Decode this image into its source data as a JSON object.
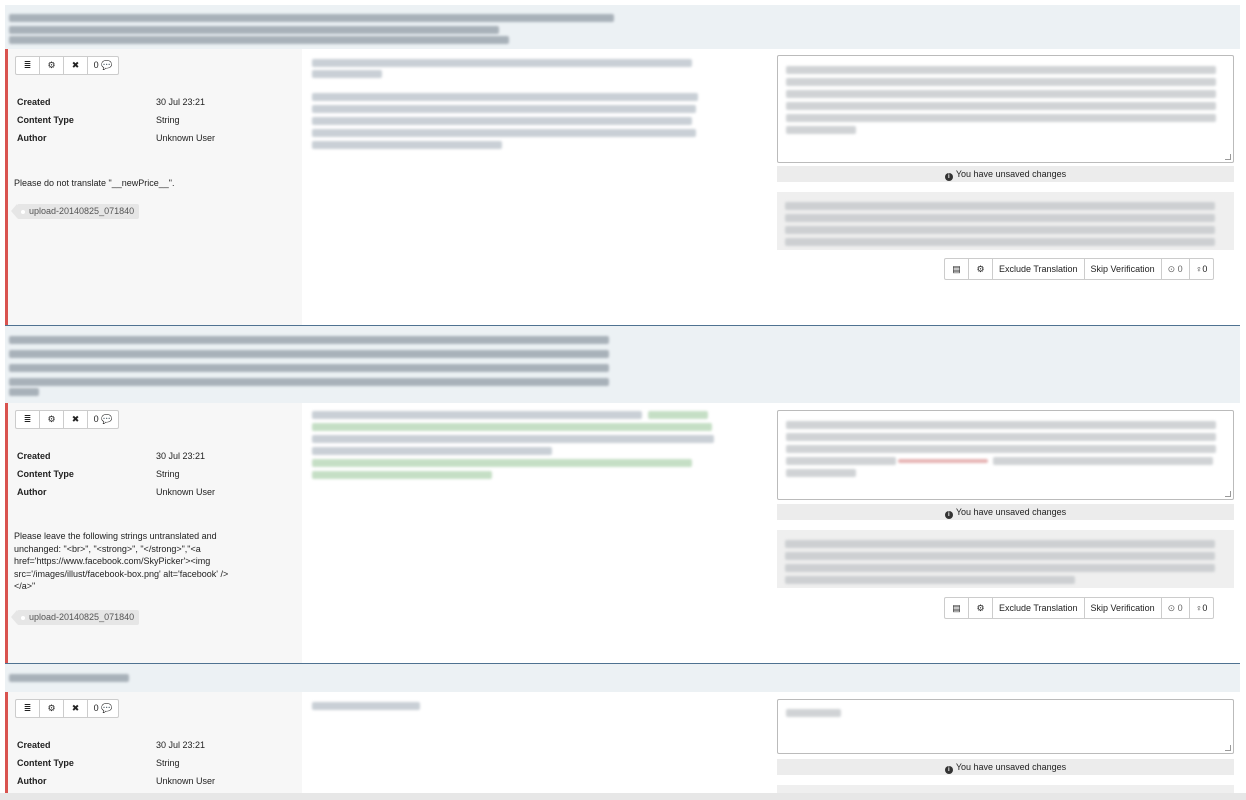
{
  "toolbar_buttons": {
    "list_icon": "≣",
    "gear_icon": "⚙",
    "close_icon": "✖",
    "comments_label": "0 💬"
  },
  "meta_labels": {
    "created": "Created",
    "content_type": "Content Type",
    "author": "Author"
  },
  "units": [
    {
      "created": "30 Jul 23:21",
      "content_type": "String",
      "author": "Unknown User",
      "note": "Please do not translate \"__newPrice__\".",
      "tag": "upload-20140825_071840",
      "unsaved": "You have unsaved changes",
      "actions": {
        "exclude": "Exclude Translation",
        "skip": "Skip Verification",
        "votes_down": "0",
        "votes_up": "0"
      }
    },
    {
      "created": "30 Jul 23:21",
      "content_type": "String",
      "author": "Unknown User",
      "note": "Please leave the following strings untranslated and unchanged: \"<br>\", \"<strong>\", \"</strong>\",\"<a href='https://www.facebook.com/SkyPicker'><img src='/images/illust/facebook-box.png' alt='facebook' /></a>\"",
      "tag": "upload-20140825_071840",
      "unsaved": "You have unsaved changes",
      "actions": {
        "exclude": "Exclude Translation",
        "skip": "Skip Verification",
        "votes_down": "0",
        "votes_up": "0"
      }
    },
    {
      "created": "30 Jul 23:21",
      "content_type": "String",
      "author": "Unknown User",
      "unsaved": "You have unsaved changes"
    }
  ],
  "icons": {
    "list": "list-icon",
    "gear": "gear-icon",
    "close": "close-icon",
    "comment": "comment-icon",
    "copy": "copy-source-icon",
    "cogs": "machine-translate-icon",
    "info": "info-icon",
    "clock": "history-icon",
    "bulb": "suggestion-icon"
  },
  "colors": {
    "accent_bar": "#d9534f",
    "divider": "#4f7291",
    "header_bg": "#ecf1f4"
  }
}
